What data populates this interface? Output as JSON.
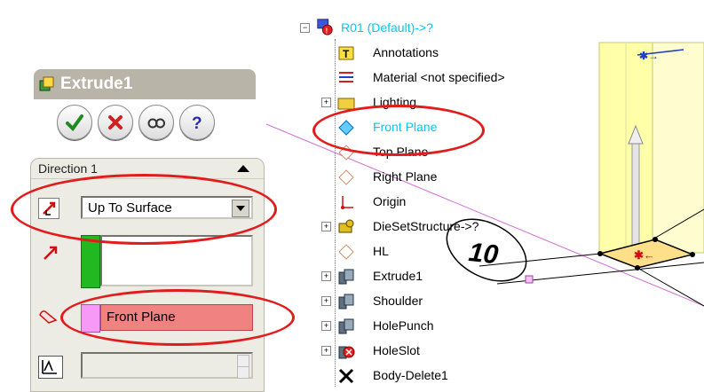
{
  "property_manager": {
    "title": "Extrude1",
    "buttons": [
      {
        "name": "ok-button",
        "icon": "check-icon",
        "color": "#1f8a1f"
      },
      {
        "name": "cancel-button",
        "icon": "x-icon",
        "color": "#d02020"
      },
      {
        "name": "preview-button",
        "icon": "glasses-icon",
        "color": "#333333"
      },
      {
        "name": "help-button",
        "icon": "question-icon",
        "color": "#2a2aa8"
      }
    ],
    "direction1": {
      "header": "Direction 1",
      "end_condition": "Up To Surface",
      "face_plane": "Front Plane"
    }
  },
  "tree": {
    "root": "R01  (Default)->?",
    "items": [
      {
        "label": "Annotations",
        "icon": "annotations-icon",
        "expander": false
      },
      {
        "label": "Material <not specified>",
        "icon": "material-icon",
        "expander": false
      },
      {
        "label": "Lighting",
        "icon": "lighting-icon",
        "expander": true
      },
      {
        "label": "Front Plane",
        "icon": "plane-icon",
        "expander": false,
        "selected": true
      },
      {
        "label": "Top Plane",
        "icon": "plane-icon",
        "expander": false
      },
      {
        "label": "Right Plane",
        "icon": "plane-icon",
        "expander": false
      },
      {
        "label": "Origin",
        "icon": "origin-icon",
        "expander": false
      },
      {
        "label": "DieSetStructure->?",
        "icon": "dieset-icon",
        "expander": true
      },
      {
        "label": "HL",
        "icon": "plane-icon",
        "expander": false
      },
      {
        "label": "Extrude1",
        "icon": "extrude-icon",
        "expander": true
      },
      {
        "label": "Shoulder",
        "icon": "extrude-icon",
        "expander": true
      },
      {
        "label": "HolePunch",
        "icon": "extrude-icon",
        "expander": true
      },
      {
        "label": "HoleSlot",
        "icon": "error-extrude-icon",
        "expander": true
      },
      {
        "label": "Body-Delete1",
        "icon": "body-delete-icon",
        "expander": false
      }
    ]
  },
  "viewport": {
    "dimension_value": "10"
  },
  "colors": {
    "accent_selected": "#00c8ff",
    "annotation_red": "#e21c1c",
    "pm_title_bar": "#b9b4a8",
    "model_yellow": "#ffff99"
  }
}
